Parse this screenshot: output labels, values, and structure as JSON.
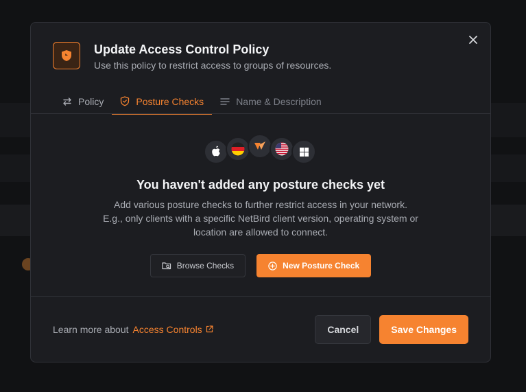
{
  "colors": {
    "accent": "#f68330",
    "modal_bg": "#1c1d21",
    "overlay_bg": "#111214"
  },
  "modal": {
    "title": "Update Access Control Policy",
    "subtitle": "Use this policy to restrict access to groups of resources.",
    "header_icon": "shield-icon",
    "close_icon": "close-icon"
  },
  "tabs": [
    {
      "label": "Policy",
      "icon": "arrows-swap-icon",
      "active": false
    },
    {
      "label": "Posture Checks",
      "icon": "shield-check-icon",
      "active": true
    },
    {
      "label": "Name & Description",
      "icon": "lines-icon",
      "active": false
    }
  ],
  "empty_state": {
    "icons": [
      "apple-icon",
      "germany-flag-icon",
      "netbird-logo-icon",
      "us-flag-icon",
      "windows-icon"
    ],
    "title": "You haven't added any posture checks yet",
    "description": "Add various posture checks to further restrict access in your network. E.g., only clients with a specific NetBird client version, operating system or location are allowed to connect.",
    "browse_label": "Browse Checks",
    "new_label": "New Posture Check"
  },
  "footer": {
    "learn_text": "Learn more about",
    "learn_link": "Access Controls",
    "cancel_label": "Cancel",
    "save_label": "Save Changes"
  }
}
